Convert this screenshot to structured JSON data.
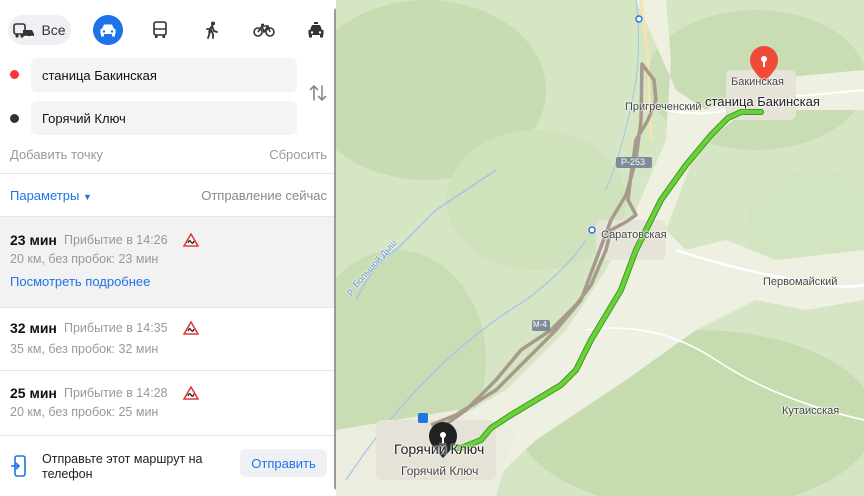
{
  "modes": {
    "all_label": "Все",
    "items": [
      "all-transport",
      "car",
      "bus",
      "walking",
      "bicycle",
      "taxi"
    ],
    "active": "car"
  },
  "waypoints": {
    "from": "станица Бакинская",
    "to": "Горячий Ключ",
    "from_color": "#ff3333",
    "to_color": "#333333"
  },
  "actions": {
    "add_point": "Добавить точку",
    "reset": "Сбросить"
  },
  "options": {
    "parameters": "Параметры",
    "departure": "Отправление сейчас"
  },
  "routes": [
    {
      "time": "23 мин",
      "arrival": "Прибытие в 14:26",
      "details": "20 км, без пробок: 23 мин",
      "more": "Посмотреть подробнее",
      "active": true
    },
    {
      "time": "32 мин",
      "arrival": "Прибытие в 14:35",
      "details": "35 км, без пробок: 32 мин"
    },
    {
      "time": "25 мин",
      "arrival": "Прибытие в 14:28",
      "details": "20 км, без пробок: 25 мин"
    }
  ],
  "send": {
    "text": "Отправьте этот маршрут на телефон",
    "button": "Отправить"
  },
  "map": {
    "labels": {
      "bakinskaya_short": "Бакинская",
      "bakinskaya": "станица Бакинская",
      "prigrechensky": "Пригреченский",
      "saratovskaya": "Саратовская",
      "pervomaisky": "Первомайский",
      "kutaisskaya": "Кутаисская",
      "goryachy_big": "Горячий Ключ",
      "goryachy": "Горячий Ключ",
      "river": "р. Большой Дыш",
      "road_a": "М-4",
      "road_b": "P-253"
    },
    "colors": {
      "active_route": "#6bd13a",
      "alt_route": "#a69a8c",
      "accent": "#1e73e8",
      "destination_pin": "#f04a38"
    }
  }
}
